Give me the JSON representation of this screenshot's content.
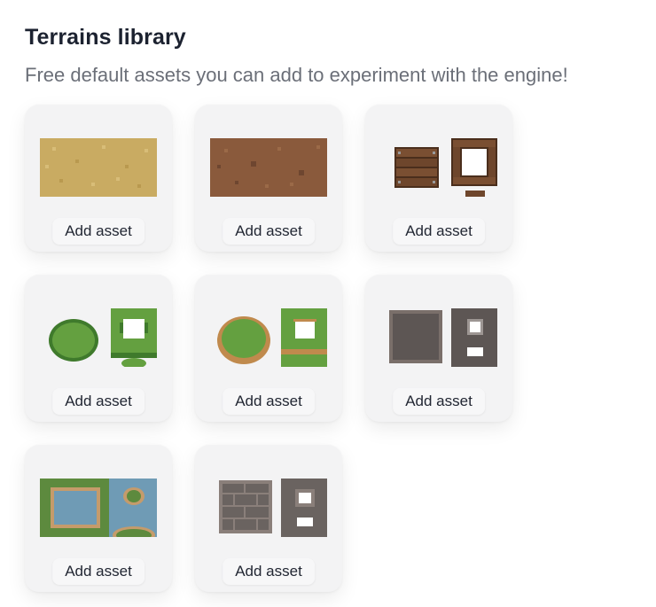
{
  "header": {
    "title": "Terrains library",
    "subtitle": "Free default assets you can add to experiment with the engine!"
  },
  "assets": [
    {
      "icon": "sand-terrain-icon",
      "button_label": "Add asset"
    },
    {
      "icon": "dirt-terrain-icon",
      "button_label": "Add asset"
    },
    {
      "icon": "wooden-planks-terrain-icon",
      "button_label": "Add asset"
    },
    {
      "icon": "grass-terrain-icon",
      "button_label": "Add asset"
    },
    {
      "icon": "grass-dirt-edge-terrain-icon",
      "button_label": "Add asset"
    },
    {
      "icon": "stone-terrain-icon",
      "button_label": "Add asset"
    },
    {
      "icon": "water-grass-terrain-icon",
      "button_label": "Add asset"
    },
    {
      "icon": "stone-bricks-terrain-icon",
      "button_label": "Add asset"
    }
  ]
}
